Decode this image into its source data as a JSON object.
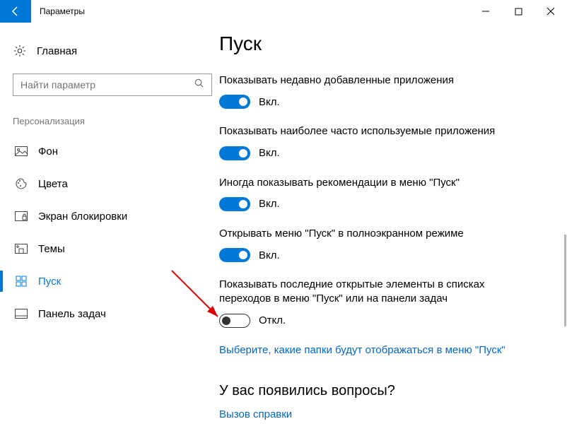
{
  "window": {
    "title": "Параметры"
  },
  "sidebar": {
    "home": "Главная",
    "search_placeholder": "Найти параметр",
    "section": "Персонализация",
    "items": [
      {
        "label": "Фон"
      },
      {
        "label": "Цвета"
      },
      {
        "label": "Экран блокировки"
      },
      {
        "label": "Темы"
      },
      {
        "label": "Пуск"
      },
      {
        "label": "Панель задач"
      }
    ]
  },
  "page": {
    "title": "Пуск",
    "settings": [
      {
        "label": "Показывать недавно добавленные приложения",
        "state_text": "Вкл.",
        "on": true
      },
      {
        "label": "Показывать наиболее часто используемые приложения",
        "state_text": "Вкл.",
        "on": true
      },
      {
        "label": "Иногда показывать рекомендации в меню \"Пуск\"",
        "state_text": "Вкл.",
        "on": true
      },
      {
        "label": "Открывать меню \"Пуск\" в полноэкранном режиме",
        "state_text": "Вкл.",
        "on": true
      },
      {
        "label": "Показывать последние открытые элементы в списках переходов в меню \"Пуск\" или на панели задач",
        "state_text": "Откл.",
        "on": false
      }
    ],
    "folders_link": "Выберите, какие папки будут отображаться в меню \"Пуск\"",
    "help_heading": "У вас появились вопросы?",
    "help_link": "Вызов справки"
  }
}
